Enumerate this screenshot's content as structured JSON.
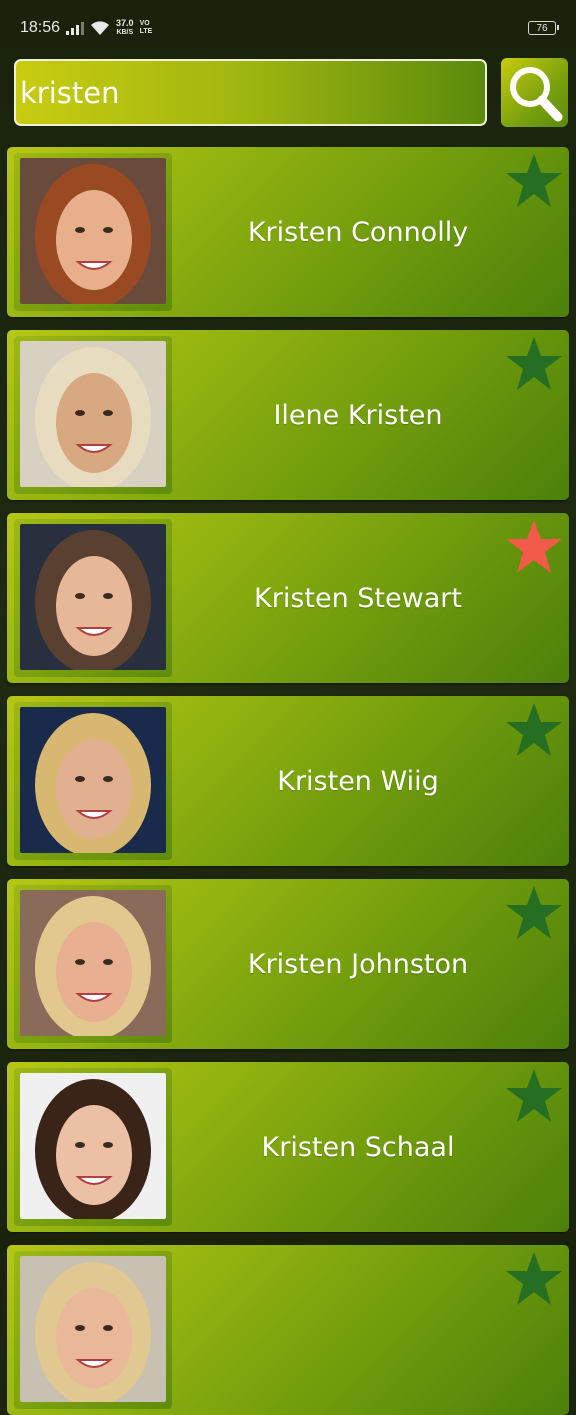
{
  "status_bar": {
    "time": "18:56",
    "net_speed_value": "37.0",
    "net_speed_unit": "KB/S",
    "volte_top": "VO",
    "volte_bottom": "LTE",
    "battery": "76"
  },
  "search": {
    "value": "kristen",
    "icon": "search-icon"
  },
  "colors": {
    "favorite_on": "#f25a4a",
    "favorite_off": "#266e22",
    "card_gradient_start": "#b6c614",
    "card_gradient_end": "#4c800a"
  },
  "results": [
    {
      "name": "Kristen Connolly",
      "favorite": false,
      "hair": "#9a4a22",
      "skin": "#e8b08a",
      "bg": "#6a4a3a"
    },
    {
      "name": "Ilene Kristen",
      "favorite": false,
      "hair": "#e8dcc0",
      "skin": "#d8a880",
      "bg": "#d8d0c0"
    },
    {
      "name": "Kristen Stewart",
      "favorite": true,
      "hair": "#5a4030",
      "skin": "#e6b898",
      "bg": "#283040"
    },
    {
      "name": "Kristen Wiig",
      "favorite": false,
      "hair": "#d8b870",
      "skin": "#e0b090",
      "bg": "#1a2a4a"
    },
    {
      "name": "Kristen Johnston",
      "favorite": false,
      "hair": "#e2c88e",
      "skin": "#e8b090",
      "bg": "#8a6a58"
    },
    {
      "name": "Kristen Schaal",
      "favorite": false,
      "hair": "#3a2418",
      "skin": "#ecc0a4",
      "bg": "#f0f0f0"
    },
    {
      "name": "",
      "favorite": false,
      "hair": "#e0c890",
      "skin": "#e8b898",
      "bg": "#c8c0b0"
    }
  ]
}
